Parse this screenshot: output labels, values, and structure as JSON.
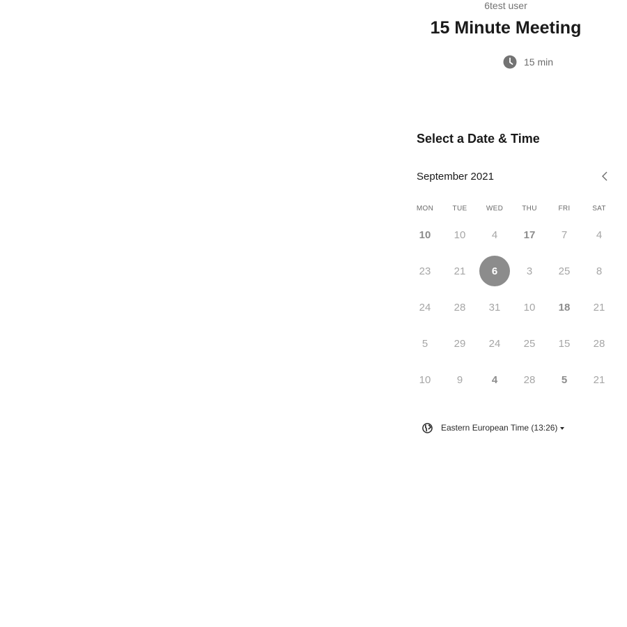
{
  "event": {
    "user_name": "6test user",
    "title": "15 Minute Meeting",
    "duration": "15 min",
    "duration_icon": "clock-icon"
  },
  "calendar": {
    "heading": "Select a Date & Time",
    "month_label": "September 2021",
    "prev_icon": "chevron-left-icon",
    "weekdays": [
      "MON",
      "TUE",
      "WED",
      "THU",
      "FRI",
      "SAT"
    ],
    "weeks": [
      [
        {
          "day": "10",
          "available": true
        },
        {
          "day": "10",
          "available": false
        },
        {
          "day": "4",
          "available": false
        },
        {
          "day": "17",
          "available": true
        },
        {
          "day": "7",
          "available": false
        },
        {
          "day": "4",
          "available": false
        }
      ],
      [
        {
          "day": "23",
          "available": false
        },
        {
          "day": "21",
          "available": false
        },
        {
          "day": "6",
          "available": true,
          "selected": true
        },
        {
          "day": "3",
          "available": false
        },
        {
          "day": "25",
          "available": false
        },
        {
          "day": "8",
          "available": false
        }
      ],
      [
        {
          "day": "24",
          "available": false
        },
        {
          "day": "28",
          "available": false
        },
        {
          "day": "31",
          "available": false
        },
        {
          "day": "10",
          "available": false
        },
        {
          "day": "18",
          "available": true
        },
        {
          "day": "21",
          "available": false
        }
      ],
      [
        {
          "day": "5",
          "available": false
        },
        {
          "day": "29",
          "available": false
        },
        {
          "day": "24",
          "available": false
        },
        {
          "day": "25",
          "available": false
        },
        {
          "day": "15",
          "available": false
        },
        {
          "day": "28",
          "available": false
        }
      ],
      [
        {
          "day": "10",
          "available": false
        },
        {
          "day": "9",
          "available": false
        },
        {
          "day": "4",
          "available": true
        },
        {
          "day": "28",
          "available": false
        },
        {
          "day": "5",
          "available": true
        },
        {
          "day": "21",
          "available": false
        }
      ]
    ]
  },
  "timezone": {
    "label": "Eastern European Time (13:26)",
    "icon": "globe-icon"
  },
  "colors": {
    "selected_day_bg": "#8c8c8c",
    "available_day_text": "#8c8c8c",
    "unavailable_day_text": "#a6a6a6"
  }
}
